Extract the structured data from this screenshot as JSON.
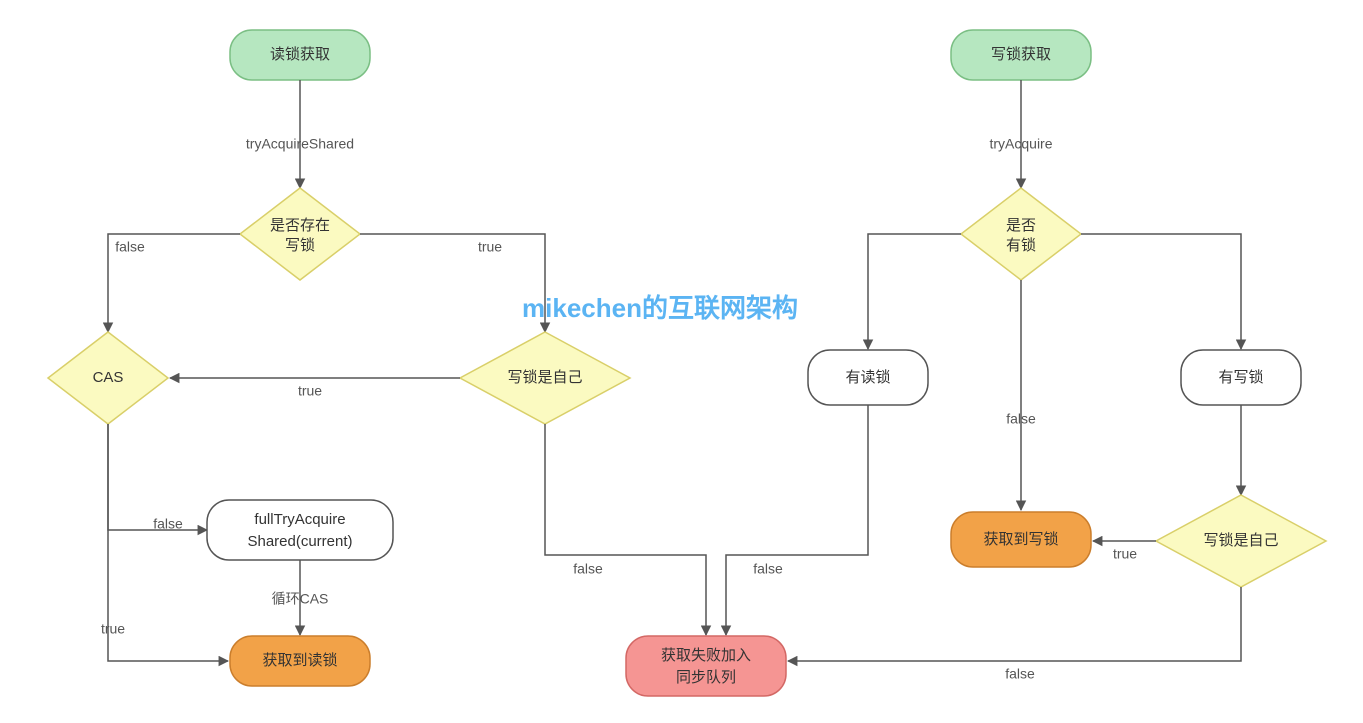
{
  "watermark": "mikechen的互联网架构",
  "nodes": {
    "A_start": {
      "label": "读锁获取"
    },
    "A_try": {
      "label": "tryAcquireShared"
    },
    "A_hasWrite": {
      "line1": "是否存在",
      "line2": "写锁"
    },
    "A_cas": {
      "label": "CAS"
    },
    "A_writeSelf": {
      "label": "写锁是自己"
    },
    "A_fulltry": {
      "line1": "fullTryAcquire",
      "line2": "Shared(current)"
    },
    "A_loop": {
      "label": "循环CAS"
    },
    "A_gotRead": {
      "label": "获取到读锁"
    },
    "B_start": {
      "label": "写锁获取"
    },
    "B_try": {
      "label": "tryAcquire"
    },
    "B_hasLock": {
      "line1": "是否",
      "line2": "有锁"
    },
    "B_hasRead": {
      "label": "有读锁"
    },
    "B_hasWrite": {
      "label": "有写锁"
    },
    "B_writeSelf": {
      "label": "写锁是自己"
    },
    "B_gotWrite": {
      "label": "获取到写锁"
    },
    "B_failQueue": {
      "line1": "获取失败加入",
      "line2": "同步队列"
    }
  },
  "edges": {
    "false": "false",
    "true": "true"
  }
}
